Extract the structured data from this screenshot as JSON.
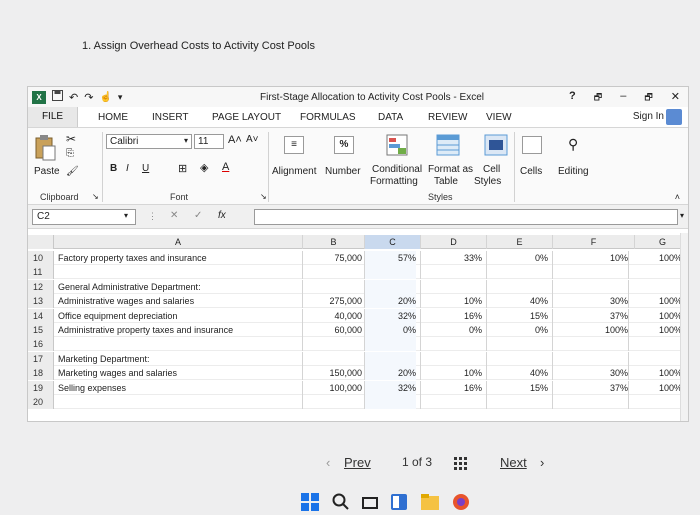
{
  "question": "1. Assign Overhead Costs to Activity Cost Pools",
  "window": {
    "title": "First-Stage Allocation to Activity Cost Pools - Excel",
    "help": "?",
    "minimize": "–",
    "restore": "🗗",
    "close": "✕"
  },
  "tabs": [
    "FILE",
    "HOME",
    "INSERT",
    "PAGE LAYOUT",
    "FORMULAS",
    "DATA",
    "REVIEW",
    "VIEW"
  ],
  "sign_in": "Sign In",
  "ribbon": {
    "paste": "Paste",
    "clipboard": "Clipboard",
    "font_name": "Calibri",
    "font_size": "11",
    "bold": "B",
    "italic": "I",
    "underline": "U",
    "font_group": "Font",
    "alignment": "Alignment",
    "number": "Number",
    "percent": "%",
    "conditional": "Conditional",
    "formatting": "Formatting",
    "format_as": "Format as",
    "table": "Table",
    "cell": "Cell",
    "styles_btn": "Styles",
    "styles_group": "Styles",
    "cells": "Cells",
    "editing": "Editing"
  },
  "formula_bar": {
    "name_box": "C2",
    "fx": "fx",
    "cancel": "✕",
    "enter": "✓"
  },
  "columns": [
    "A",
    "B",
    "C",
    "D",
    "E",
    "F",
    "G"
  ],
  "rows": [
    {
      "n": "10",
      "a": "Factory property taxes and insurance",
      "b": "75,000",
      "c": "57%",
      "d": "33%",
      "e": "0%",
      "f": "10%",
      "g": "100%"
    },
    {
      "n": "11",
      "a": "",
      "b": "",
      "c": "",
      "d": "",
      "e": "",
      "f": "",
      "g": ""
    },
    {
      "n": "12",
      "a": "General Administrative Department:",
      "b": "",
      "c": "",
      "d": "",
      "e": "",
      "f": "",
      "g": ""
    },
    {
      "n": "13",
      "a": "Administrative wages and salaries",
      "b": "275,000",
      "c": "20%",
      "d": "10%",
      "e": "40%",
      "f": "30%",
      "g": "100%"
    },
    {
      "n": "14",
      "a": "Office equipment depreciation",
      "b": "40,000",
      "c": "32%",
      "d": "16%",
      "e": "15%",
      "f": "37%",
      "g": "100%"
    },
    {
      "n": "15",
      "a": "Administrative property taxes and insurance",
      "b": "60,000",
      "c": "0%",
      "d": "0%",
      "e": "0%",
      "f": "100%",
      "g": "100%"
    },
    {
      "n": "16",
      "a": "",
      "b": "",
      "c": "",
      "d": "",
      "e": "",
      "f": "",
      "g": ""
    },
    {
      "n": "17",
      "a": "Marketing Department:",
      "b": "",
      "c": "",
      "d": "",
      "e": "",
      "f": "",
      "g": ""
    },
    {
      "n": "18",
      "a": "Marketing wages and salaries",
      "b": "150,000",
      "c": "20%",
      "d": "10%",
      "e": "40%",
      "f": "30%",
      "g": "100%"
    },
    {
      "n": "19",
      "a": "Selling expenses",
      "b": "100,000",
      "c": "32%",
      "d": "16%",
      "e": "15%",
      "f": "37%",
      "g": "100%"
    },
    {
      "n": "20",
      "a": "",
      "b": "",
      "c": "",
      "d": "",
      "e": "",
      "f": "",
      "g": ""
    }
  ],
  "pager": {
    "prev": "Prev",
    "page": "1 of 3",
    "next": "Next"
  },
  "colors": {
    "excel_green": "#217346",
    "grid_line": "#d4d4d4",
    "header_bg": "#ececec",
    "selected_col": "#c9d9ee"
  }
}
